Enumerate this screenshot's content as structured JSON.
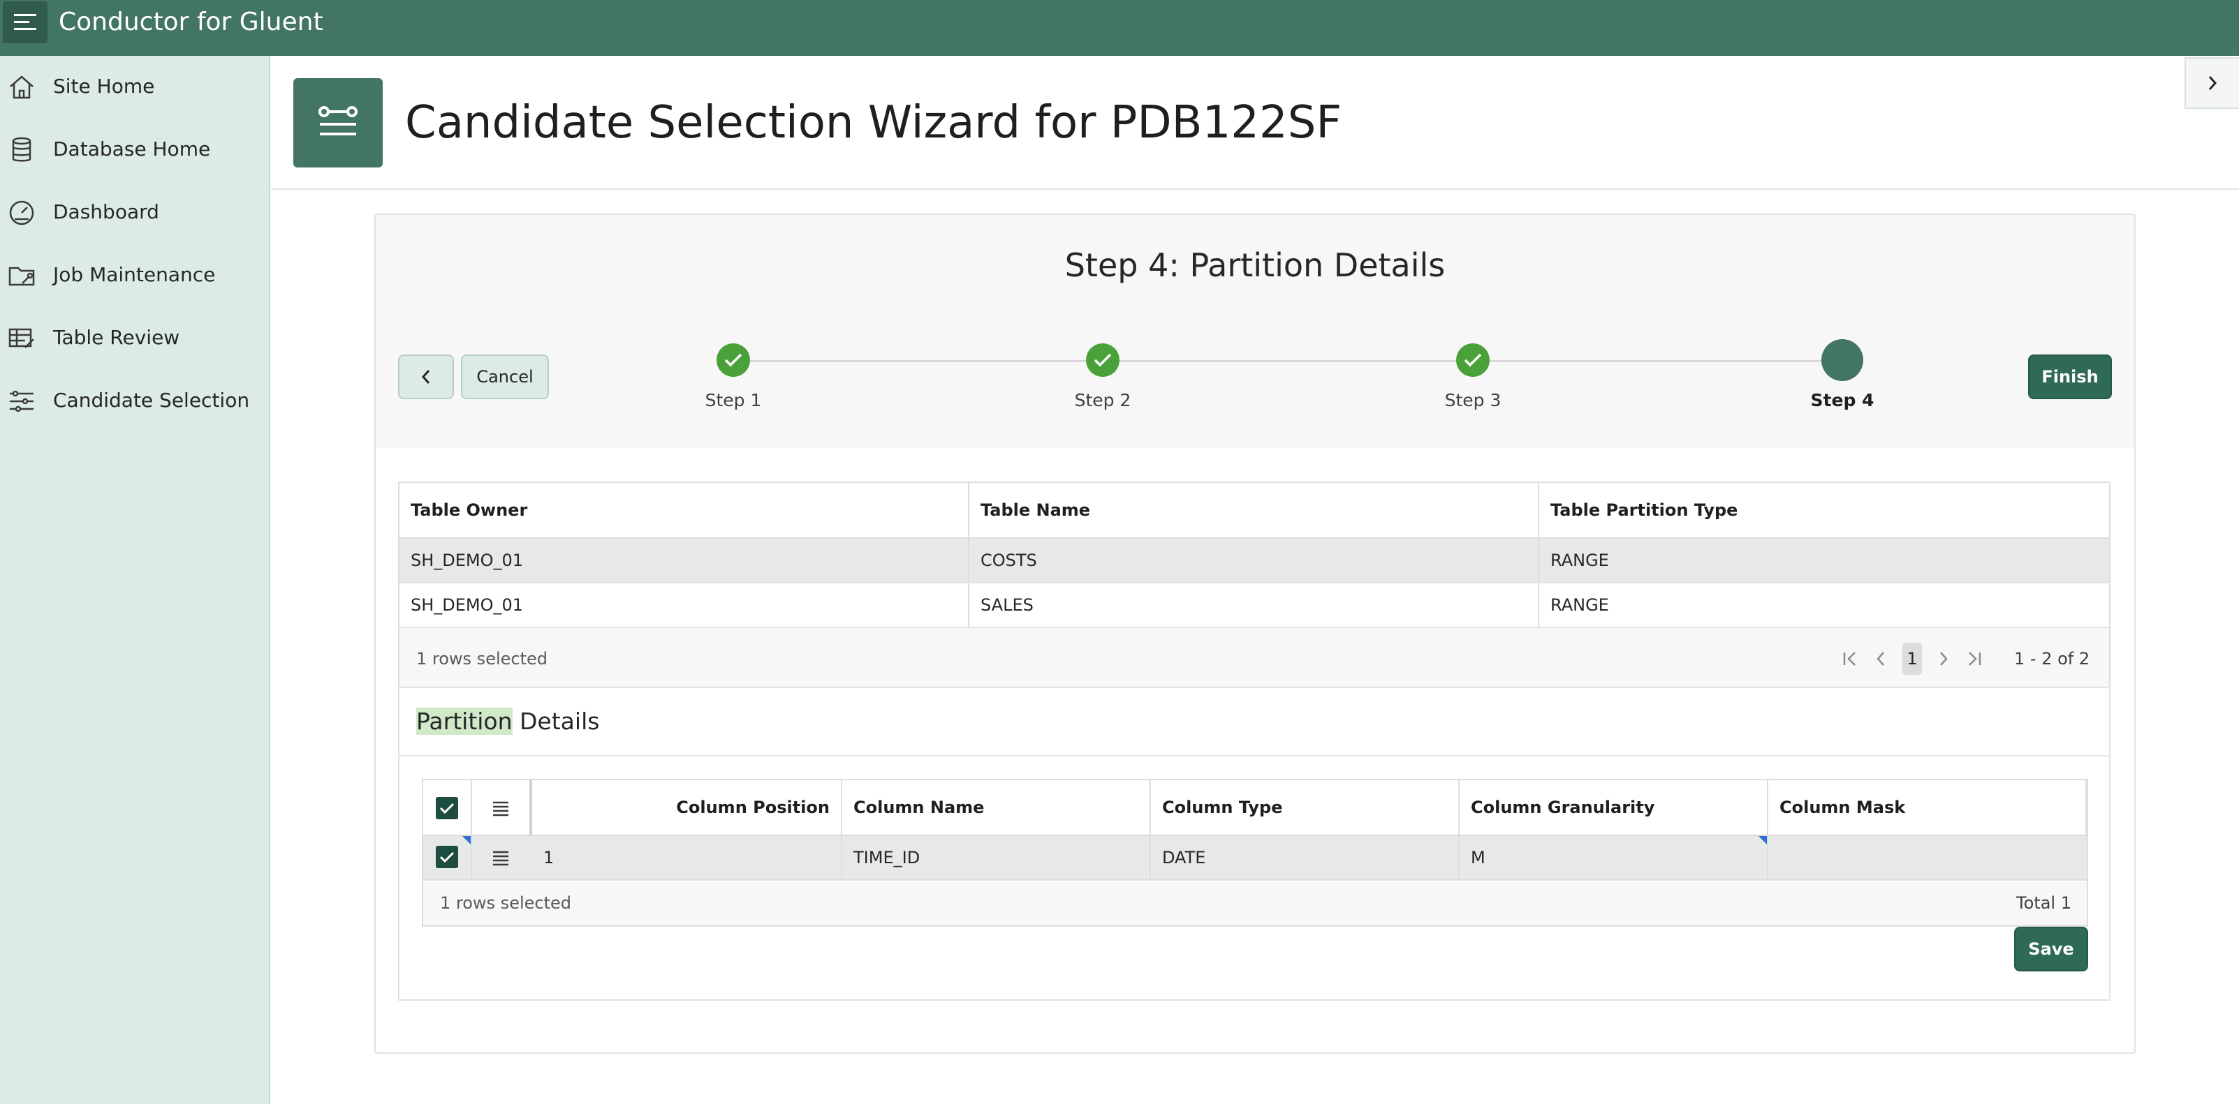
{
  "app": {
    "title": "Conductor for Gluent"
  },
  "sidebar": {
    "items": [
      {
        "label": "Site Home",
        "icon": "home-icon"
      },
      {
        "label": "Database Home",
        "icon": "database-icon"
      },
      {
        "label": "Dashboard",
        "icon": "gauge-icon"
      },
      {
        "label": "Job Maintenance",
        "icon": "folder-wrench-icon"
      },
      {
        "label": "Table Review",
        "icon": "table-edit-icon"
      },
      {
        "label": "Candidate Selection",
        "icon": "sliders-icon"
      }
    ]
  },
  "header": {
    "title": "Candidate Selection Wizard for PDB122SF",
    "icon": "wizard-icon"
  },
  "wizard": {
    "step_title": "Step 4: Partition Details",
    "cancel_label": "Cancel",
    "finish_label": "Finish",
    "steps": [
      {
        "label": "Step 1",
        "state": "complete"
      },
      {
        "label": "Step 2",
        "state": "complete"
      },
      {
        "label": "Step 3",
        "state": "complete"
      },
      {
        "label": "Step 4",
        "state": "current"
      }
    ],
    "colors": {
      "complete": "#4aa139",
      "current": "#437566",
      "primary": "#2f6a57"
    }
  },
  "tables_grid": {
    "columns": [
      "Table Owner",
      "Table Name",
      "Table Partition Type"
    ],
    "rows": [
      {
        "owner": "SH_DEMO_01",
        "name": "COSTS",
        "type": "RANGE",
        "selected": true
      },
      {
        "owner": "SH_DEMO_01",
        "name": "SALES",
        "type": "RANGE",
        "selected": false
      }
    ],
    "selection_status": "1 rows selected",
    "current_page": "1",
    "range": "1 - 2 of 2"
  },
  "partition_details": {
    "title_highlight": "Partition",
    "title_rest": " Details",
    "columns": [
      "Column Position",
      "Column Name",
      "Column Type",
      "Column Granularity",
      "Column Mask"
    ],
    "rows": [
      {
        "position": "1",
        "name": "TIME_ID",
        "type": "DATE",
        "granularity": "M",
        "mask": ""
      }
    ],
    "selection_status": "1 rows selected",
    "total": "Total 1",
    "save_label": "Save"
  }
}
